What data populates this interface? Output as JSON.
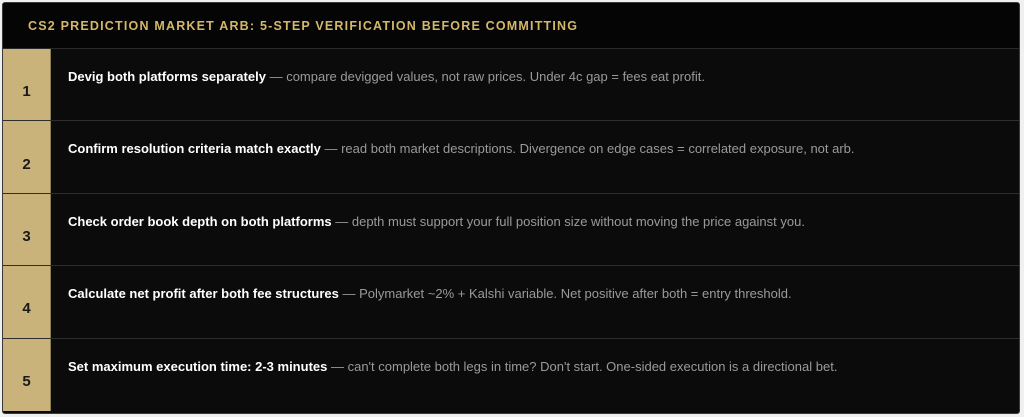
{
  "header": {
    "title": "CS2 PREDICTION MARKET ARB: 5-STEP VERIFICATION BEFORE COMMITTING"
  },
  "separator": " — ",
  "steps": [
    {
      "number": "1",
      "title": "Devig both platforms separately",
      "description": "compare devigged values, not raw prices. Under 4c gap = fees eat profit."
    },
    {
      "number": "2",
      "title": "Confirm resolution criteria match exactly",
      "description": "read both market descriptions. Divergence on edge cases = correlated exposure, not arb."
    },
    {
      "number": "3",
      "title": "Check order book depth on both platforms",
      "description": "depth must support your full position size without moving the price against you."
    },
    {
      "number": "4",
      "title": "Calculate net profit after both fee structures",
      "description": "Polymarket ~2% + Kalshi variable. Net positive after both = entry threshold."
    },
    {
      "number": "5",
      "title": "Set maximum execution time: 2-3 minutes",
      "description": "can't complete both legs in time? Don't start. One-sided execution is a directional bet."
    }
  ]
}
